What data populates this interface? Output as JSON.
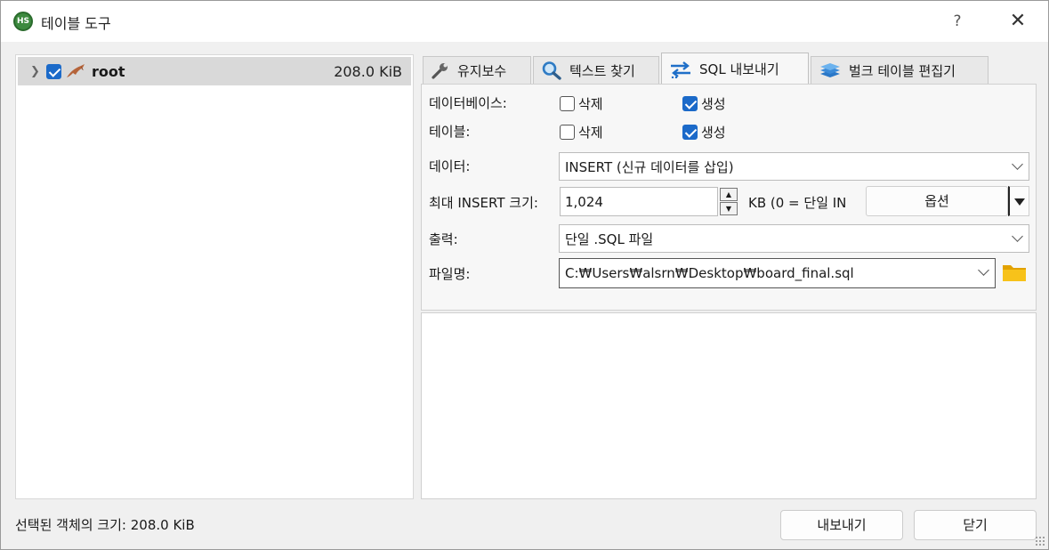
{
  "window": {
    "title": "테이블 도구",
    "help": "?",
    "close": "✕",
    "app_icon_text": "HS"
  },
  "tree": {
    "items": [
      {
        "label": "root",
        "size": "208.0 KiB",
        "checked": true
      }
    ]
  },
  "tabs": [
    {
      "label": "유지보수",
      "icon": "wrench-icon",
      "active": false
    },
    {
      "label": "텍스트 찾기",
      "icon": "magnifier-icon",
      "active": false
    },
    {
      "label": "SQL 내보내기",
      "icon": "export-arrows-icon",
      "active": true
    },
    {
      "label": "벌크 테이블 편집기",
      "icon": "layers-icon",
      "active": false
    }
  ],
  "options": {
    "database": {
      "label": "데이터베이스:",
      "drop_label": "삭제",
      "drop_checked": false,
      "create_label": "생성",
      "create_checked": true
    },
    "table": {
      "label": "테이블:",
      "drop_label": "삭제",
      "drop_checked": false,
      "create_label": "생성",
      "create_checked": true
    },
    "data": {
      "label": "데이터:",
      "value": "INSERT (신규 데이터를 삽입)"
    },
    "max_insert": {
      "label": "최대 INSERT 크기:",
      "value": "1,024",
      "unit_text": "KB (0 = 단일 IN",
      "options_button": "옵션"
    },
    "output": {
      "label": "출력:",
      "value": "단일 .SQL 파일"
    },
    "filename": {
      "label": "파일명:",
      "value": "C:₩Users₩alsrn₩Desktop₩board_final.sql"
    }
  },
  "status": {
    "text": "선택된 객체의 크기: 208.0 KiB"
  },
  "buttons": {
    "export": "내보내기",
    "close": "닫기"
  },
  "colors": {
    "checkbox": "#1b6ac9",
    "folder": "#f2b705",
    "tree_selected": "#d9d9d9"
  }
}
